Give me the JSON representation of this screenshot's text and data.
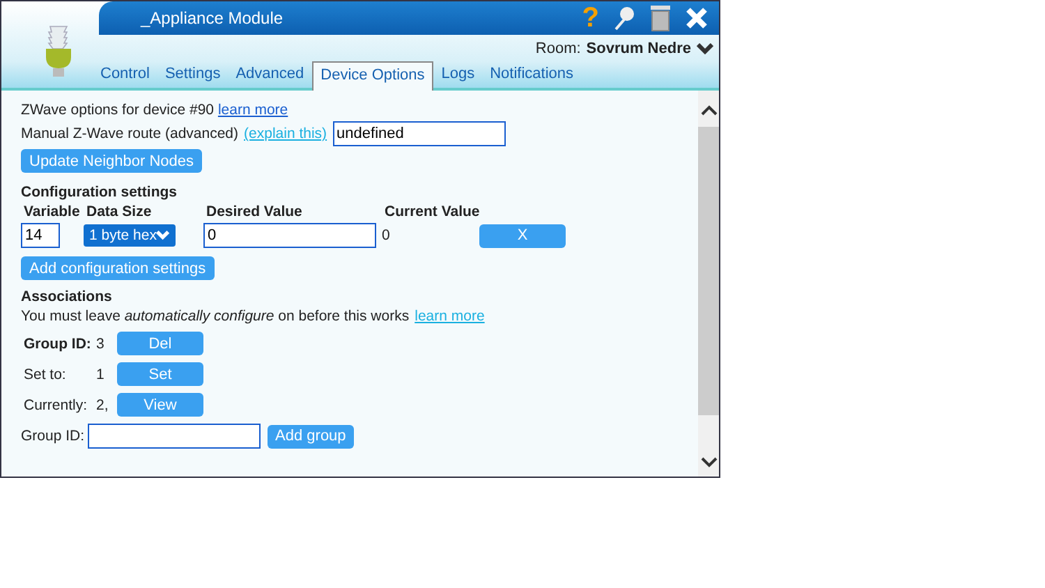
{
  "window": {
    "title": "_Appliance Module",
    "help": "?",
    "room_label": "Room:",
    "room": "Sovrum Nedre"
  },
  "tabs": [
    {
      "label": "Control",
      "selected": false
    },
    {
      "label": "Settings",
      "selected": false
    },
    {
      "label": "Advanced",
      "selected": false
    },
    {
      "label": "Device Options",
      "selected": true
    },
    {
      "label": "Logs",
      "selected": false
    },
    {
      "label": "Notifications",
      "selected": false
    }
  ],
  "zwave": {
    "text": "ZWave options for device #90",
    "link": "learn more",
    "route_label": "Manual Z-Wave route (advanced)",
    "route_link": "(explain this)",
    "route_value": "undefined",
    "button": "Update Neighbor Nodes"
  },
  "configuration": {
    "title": "Configuration settings",
    "columns": [
      "Variable",
      "Data Size",
      "Desired Value",
      "Current Value"
    ],
    "row": {
      "variable": "14",
      "data_size": "1 byte hex",
      "desired": "0",
      "current": "0",
      "remove": "X"
    },
    "add_button": "Add configuration settings"
  },
  "associations": {
    "title": "Associations",
    "note": "You must leave *automatically configure* on before this works",
    "note_link": "learn more",
    "rows": [
      {
        "kind": "heading",
        "label": "Group ID:",
        "value": "3",
        "button": "Del"
      },
      {
        "kind": "plain",
        "label": "Set to:",
        "value": "1",
        "button": "Set"
      },
      {
        "kind": "plain",
        "label": "Currently:",
        "value": "2,",
        "button": "View"
      }
    ],
    "group_label": "Group ID:",
    "add_button": "Add group"
  }
}
